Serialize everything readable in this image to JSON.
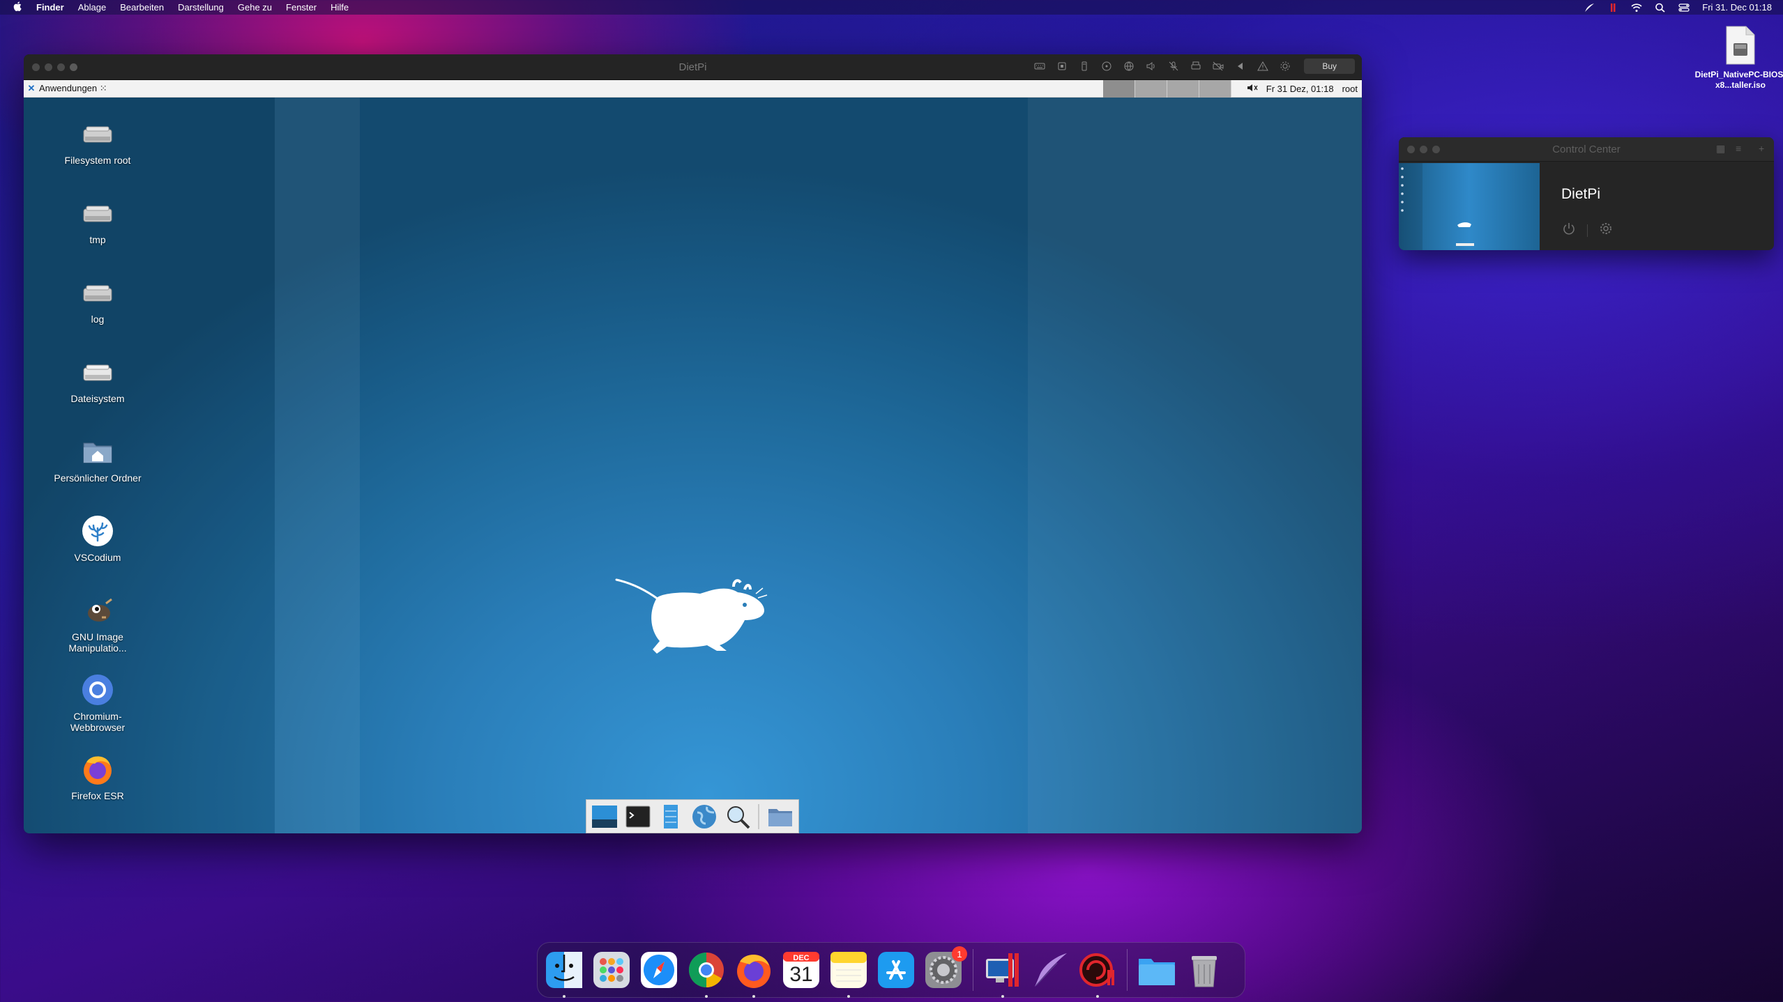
{
  "menubar": {
    "apple": "",
    "app_name": "Finder",
    "items": [
      "Ablage",
      "Bearbeiten",
      "Darstellung",
      "Gehe zu",
      "Fenster",
      "Hilfe"
    ],
    "clock": "Fri 31. Dec  01:18"
  },
  "vm_window": {
    "title": "DietPi",
    "buy_label": "Buy"
  },
  "xfce_panel": {
    "apps_menu_label": "Anwendungen ⁙",
    "datetime": "Fr 31 Dez, 01:18",
    "user": "root"
  },
  "desktop_icons": [
    {
      "label": "Filesystem root"
    },
    {
      "label": "tmp"
    },
    {
      "label": "log"
    },
    {
      "label": "Dateisystem"
    },
    {
      "label": "Persönlicher Ordner"
    },
    {
      "label": "VSCodium"
    },
    {
      "label": "GNU Image Manipulatio..."
    },
    {
      "label": "Chromium-Webbrowser"
    },
    {
      "label": "Firefox ESR"
    }
  ],
  "desktop_file": {
    "label": "DietPi_NativePC-BIOS-x8...taller.iso"
  },
  "control_center": {
    "title": "Control Center",
    "vm_name": "DietPi"
  },
  "dock": {
    "calendar_month": "DEC",
    "calendar_day": "31",
    "settings_badge": "1"
  }
}
